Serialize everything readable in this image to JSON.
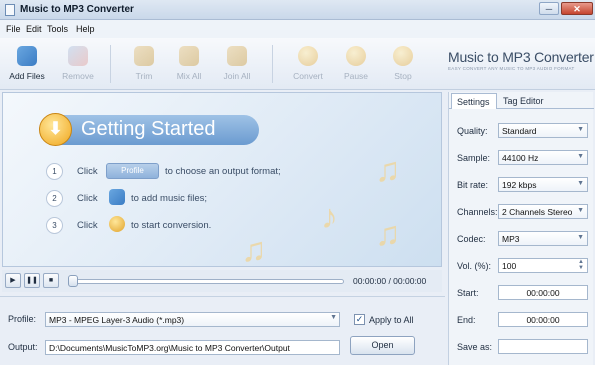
{
  "window": {
    "title": "Music to MP3 Converter",
    "minimize": "─",
    "close": "✕"
  },
  "menu": [
    "File",
    "Edit",
    "Tools",
    "Help"
  ],
  "toolbar": {
    "add_files": "Add Files",
    "remove": "Remove",
    "trim": "Trim",
    "mix_all": "Mix All",
    "join_all": "Join All",
    "convert": "Convert",
    "pause": "Pause",
    "stop": "Stop"
  },
  "brand": {
    "name": "Music to MP3 Converter",
    "tagline": "EASY CONVERT ANY MUSIC TO MP3 AUDIO FORMAT"
  },
  "getting_started": {
    "title": "Getting Started",
    "steps": [
      {
        "num": "1",
        "pre": "Click",
        "chip": "Profile",
        "post": "to choose an output format;"
      },
      {
        "num": "2",
        "pre": "Click",
        "post": "to add music files;"
      },
      {
        "num": "3",
        "pre": "Click",
        "post": "to start conversion."
      }
    ]
  },
  "transport": {
    "play": "▶",
    "pause": "❚❚",
    "stop": "■",
    "time": "00:00:00 / 00:00:00",
    "position": 0
  },
  "bottom": {
    "profile_label": "Profile:",
    "profile_value": "MP3 - MPEG Layer-3 Audio (*.mp3)",
    "apply_all": "Apply to All",
    "apply_all_checked": true,
    "output_label": "Output:",
    "output_value": "D:\\Documents\\MusicToMP3.org\\Music to MP3 Converter\\Output",
    "open": "Open"
  },
  "settings": {
    "tabs": [
      "Settings",
      "Tag Editor"
    ],
    "quality_label": "Quality:",
    "quality": "Standard",
    "sample_label": "Sample:",
    "sample": "44100 Hz",
    "bitrate_label": "Bit rate:",
    "bitrate": "192 kbps",
    "channels_label": "Channels:",
    "channels": "2 Channels Stereo",
    "codec_label": "Codec:",
    "codec": "MP3",
    "vol_label": "Vol. (%):",
    "vol": "100",
    "start_label": "Start:",
    "start": "00:00:00",
    "end_label": "End:",
    "end": "00:00:00",
    "saveas_label": "Save as:",
    "saveas": ""
  },
  "colors": {
    "accent": "#6b9bd0",
    "banner": "#9fc2e6",
    "gold": "#f0a61c"
  }
}
